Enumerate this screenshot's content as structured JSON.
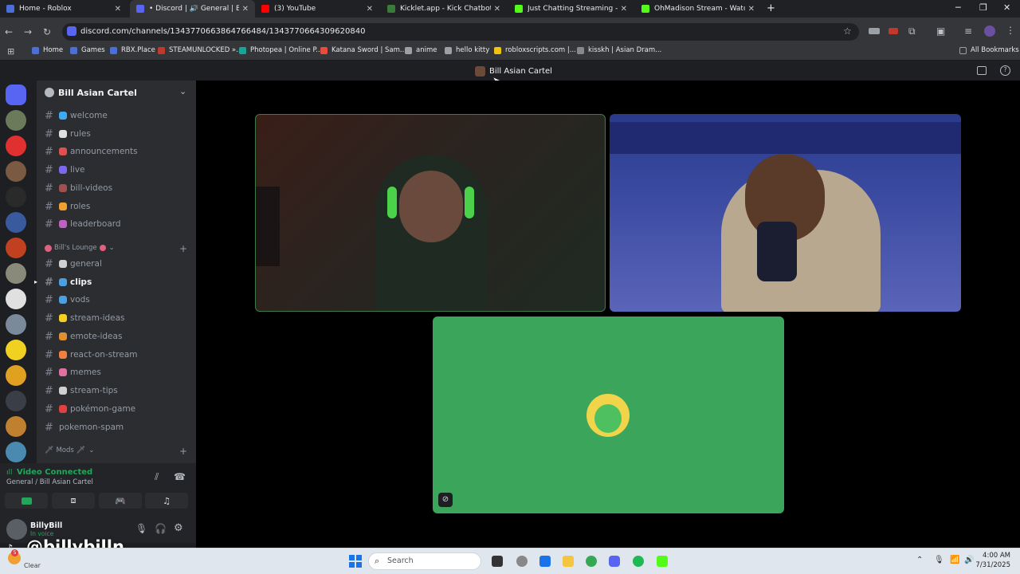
{
  "browser": {
    "tabs": [
      {
        "title": "Home - Roblox",
        "favicon_color": "#4a6fd8"
      },
      {
        "title": "• Discord | 🔊 General | Bill",
        "favicon_color": "#5865f2",
        "active": true
      },
      {
        "title": "(3) YouTube",
        "favicon_color": "#ff0000"
      },
      {
        "title": "Kicklet.app - Kick Chatbot and",
        "favicon_color": "#3a7a3a"
      },
      {
        "title": "Just Chatting Streaming - Live S",
        "favicon_color": "#53fc18"
      },
      {
        "title": "OhMadison Stream - Watch",
        "favicon_color": "#53fc18"
      }
    ],
    "url": "discord.com/channels/1343770663864766484/1343770664309620840",
    "bookmarks": [
      {
        "label": "Home",
        "color": "#4a6fd8"
      },
      {
        "label": "Games",
        "color": "#4a6fd8"
      },
      {
        "label": "RBX.Place",
        "color": "#4a6fd8"
      },
      {
        "label": "STEAMUNLOCKED »...",
        "color": "#c0392b"
      },
      {
        "label": "Photopea | Online P...",
        "color": "#18a497"
      },
      {
        "label": "Katana Sword | Sam...",
        "color": "#e74c3c"
      },
      {
        "label": "anime",
        "color": "#9aa0a6"
      },
      {
        "label": "hello kitty",
        "color": "#9aa0a6"
      },
      {
        "label": "robloxscripts.com |...",
        "color": "#f1c40f"
      },
      {
        "label": "kisskh | Asian Dram...",
        "color": "#888888"
      }
    ],
    "all_bookmarks": "All Bookmarks"
  },
  "discord": {
    "window_title": "Bill Asian Cartel",
    "server_name": "Bill Asian Cartel",
    "channels_top": [
      {
        "name": "welcome",
        "emoji_color": "#3fa9f5"
      },
      {
        "name": "rules",
        "emoji_color": "#e0e0e0"
      },
      {
        "name": "announcements",
        "emoji_color": "#e05050"
      },
      {
        "name": "live",
        "emoji_color": "#7b68ee"
      },
      {
        "name": "bill-videos",
        "emoji_color": "#a05050"
      },
      {
        "name": "roles",
        "emoji_color": "#f0a030"
      },
      {
        "name": "leaderboard",
        "emoji_color": "#c060c0"
      }
    ],
    "category_lounge": "Bill's Lounge",
    "channels_lounge": [
      {
        "name": "general",
        "emoji_color": "#d0d0d0"
      },
      {
        "name": "clips",
        "emoji_color": "#4aa0e0",
        "selected": true
      },
      {
        "name": "vods",
        "emoji_color": "#4aa0e0"
      },
      {
        "name": "stream-ideas",
        "emoji_color": "#f5d020"
      },
      {
        "name": "emote-ideas",
        "emoji_color": "#e09030"
      },
      {
        "name": "react-on-stream",
        "emoji_color": "#f08040"
      },
      {
        "name": "memes",
        "emoji_color": "#e070a0"
      },
      {
        "name": "stream-tips",
        "emoji_color": "#d0d0d0"
      },
      {
        "name": "pokémon-game",
        "emoji_color": "#e04040"
      },
      {
        "name": "pokemon-spam",
        "emoji_color": ""
      }
    ],
    "category_mods": "Mods",
    "voice": {
      "status": "Video Connected",
      "location": "General / Bill Asian Cartel"
    },
    "user": {
      "name": "BillyBill",
      "status": "In voice"
    },
    "watermark": "@billybilln",
    "clear_label": "Clear"
  },
  "taskbar": {
    "search_placeholder": "Search",
    "time": "4:00 AM",
    "date": "7/31/2025"
  }
}
